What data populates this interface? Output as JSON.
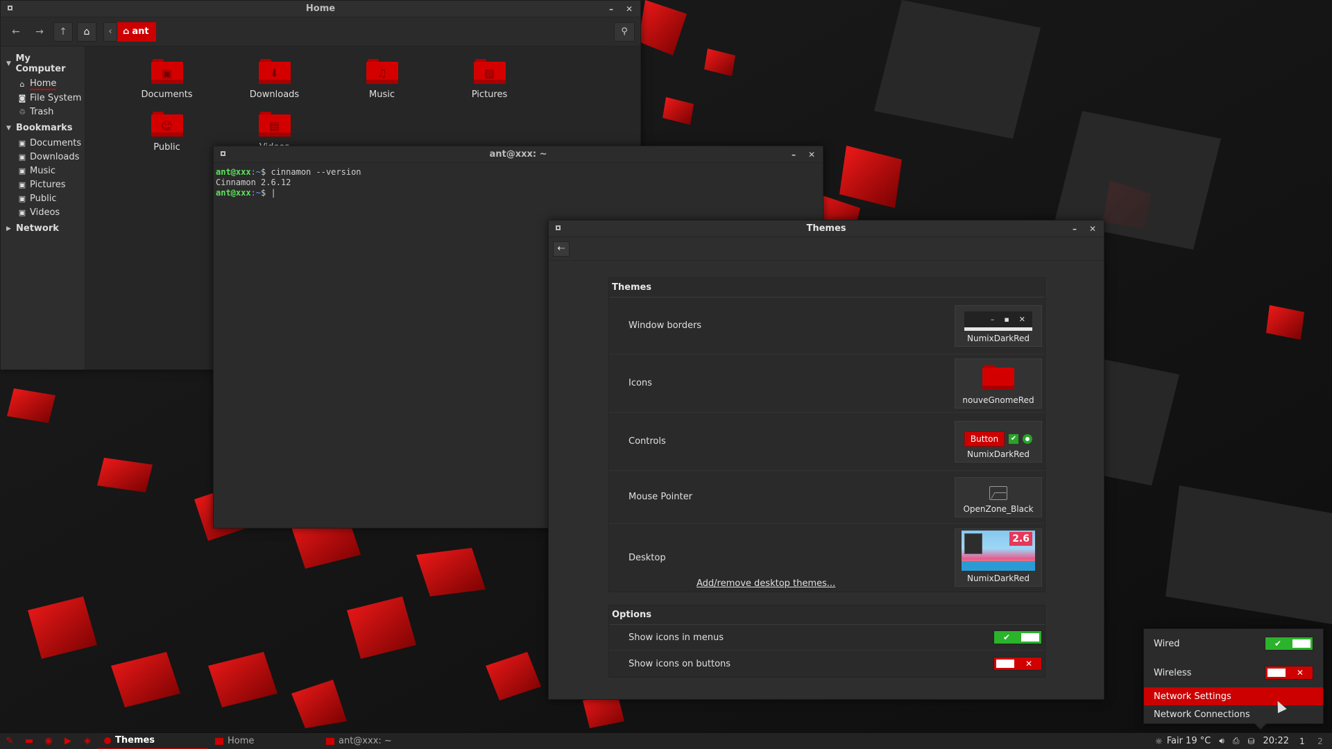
{
  "file_manager": {
    "title": "Home",
    "path_crumb": "ant",
    "sidebar": {
      "my_computer": "My Computer",
      "computer_items": [
        {
          "label": "Home",
          "icon": "home-icon"
        },
        {
          "label": "File System",
          "icon": "drive-icon"
        },
        {
          "label": "Trash",
          "icon": "trash-icon"
        }
      ],
      "bookmarks": "Bookmarks",
      "bookmark_items": [
        {
          "label": "Documents"
        },
        {
          "label": "Downloads"
        },
        {
          "label": "Music"
        },
        {
          "label": "Pictures"
        },
        {
          "label": "Public"
        },
        {
          "label": "Videos"
        }
      ],
      "network": "Network"
    },
    "files": [
      {
        "label": "Documents",
        "glyph": "▣"
      },
      {
        "label": "Downloads",
        "glyph": "⬇"
      },
      {
        "label": "Music",
        "glyph": "♫"
      },
      {
        "label": "Pictures",
        "glyph": "▧"
      },
      {
        "label": "Public",
        "glyph": "☺"
      },
      {
        "label": "Videos",
        "glyph": "▤"
      }
    ]
  },
  "terminal": {
    "title": "ant@xxx: ~",
    "lines": [
      {
        "user": "ant@xxx",
        "path": ":~",
        "prompt": "$ ",
        "cmd": "cinnamon --version"
      },
      {
        "output": "Cinnamon 2.6.12"
      },
      {
        "user": "ant@xxx",
        "path": ":~",
        "prompt": "$ ",
        "cmd": "|"
      }
    ]
  },
  "themes": {
    "title": "Themes",
    "section_themes": "Themes",
    "rows": {
      "window_borders": {
        "label": "Window borders",
        "preview": "NumixDarkRed"
      },
      "icons": {
        "label": "Icons",
        "preview": "nouveGnomeRed"
      },
      "controls": {
        "label": "Controls",
        "preview": "NumixDarkRed",
        "button_label": "Button"
      },
      "mouse_pointer": {
        "label": "Mouse Pointer",
        "preview": "OpenZone_Black"
      },
      "desktop": {
        "label": "Desktop",
        "preview": "NumixDarkRed",
        "version_badge": "2.6"
      }
    },
    "add_remove_link": "Add/remove desktop themes...",
    "section_options": "Options",
    "options": {
      "show_icons_menus": "Show icons in menus",
      "show_icons_buttons": "Show icons on buttons"
    }
  },
  "network_menu": {
    "wired": "Wired",
    "wireless": "Wireless",
    "settings": "Network Settings",
    "connections": "Network Connections"
  },
  "panel": {
    "tasks": [
      {
        "label": "Themes",
        "active": true
      },
      {
        "label": "Home",
        "active": false
      },
      {
        "label": "ant@xxx: ~",
        "active": false
      }
    ],
    "weather": "Fair 19 °C",
    "clock": "20:22",
    "workspaces": [
      "1",
      "2"
    ]
  },
  "colors": {
    "accent": "#cc0000",
    "toggle_on": "#2bb32b",
    "toggle_off": "#d10000"
  }
}
